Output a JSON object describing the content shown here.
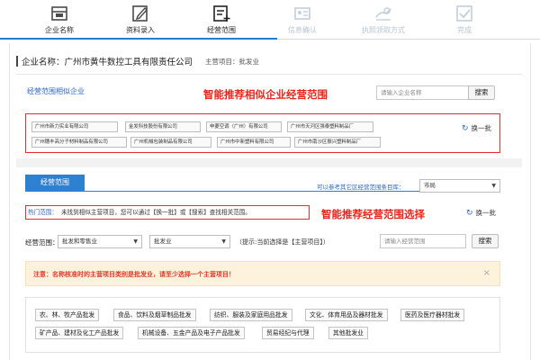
{
  "steps": [
    {
      "label": "企业名称",
      "state": "done",
      "icon": "register-icon"
    },
    {
      "label": "资料录入",
      "state": "done",
      "icon": "edit-icon"
    },
    {
      "label": "经营范围",
      "state": "current",
      "icon": "scope-list-icon"
    },
    {
      "label": "信息确认",
      "state": "todo",
      "icon": "info-confirm-icon"
    },
    {
      "label": "执照领取方式",
      "state": "todo",
      "icon": "license-pickup-icon"
    },
    {
      "label": "完成",
      "state": "todo",
      "icon": "complete-icon"
    }
  ],
  "company": {
    "name": "企业名称：广州市黄牛数控工具有限责任公司",
    "main_item": "主营项目：批发业"
  },
  "similar": {
    "title": "经营范围相似企业",
    "annotation": "智能推荐相似企业经营范围",
    "search_placeholder": "请输入企业名称",
    "search_button": "搜索",
    "refresh": "换一批",
    "companies": [
      "广州市新力实业有限公司",
      "金发科技股份有限公司",
      "申菱空调（广州）有限公司",
      "广州市天河区强泰塑料制品厂",
      "广州穗丰高分子材料制品有限公司",
      "广州机械包装制品有限公司",
      "广州市中新塑料有限公司",
      "广州市南沙区振兴塑料制品厂"
    ]
  },
  "scope": {
    "tab": "经营范围",
    "library_label": "可以参考其它区经营范围条目库：",
    "library_value": "市局",
    "hot_label": "热门范围：",
    "hot_text": "未找到相似主营项目，您可以通过【换一批】或【搜索】查找相关范围。",
    "annotation": "智能推荐经营范围选择",
    "refresh": "换一批",
    "scope_label": "经营范围：",
    "select1": "批发和零售业",
    "select2": "批发业",
    "hint": "（提示:当前选择是【主营项目】）",
    "search_placeholder": "请输入经营范围",
    "search_button": "搜索"
  },
  "warning": {
    "text": "注意：名称核准时的主营项目类别是批发业，请至少选择一个主营项目！",
    "close": "×"
  },
  "categories": [
    "农、林、牧产品批发",
    "食品、饮料及烟草制品批发",
    "纺织、服装及家庭用品批发",
    "文化、体育用品及器材批发",
    "医药及医疗器材批发",
    "矿产品、建材及化工产品批发",
    "机械设备、五金产品及电子产品批发",
    "贸易经纪与代理",
    "其他批发业"
  ],
  "colors": {
    "accent": "#1f7fd0",
    "tab": "#2e80d0",
    "note_red": "#e8251c",
    "warn_bg": "#fdf3dc"
  }
}
